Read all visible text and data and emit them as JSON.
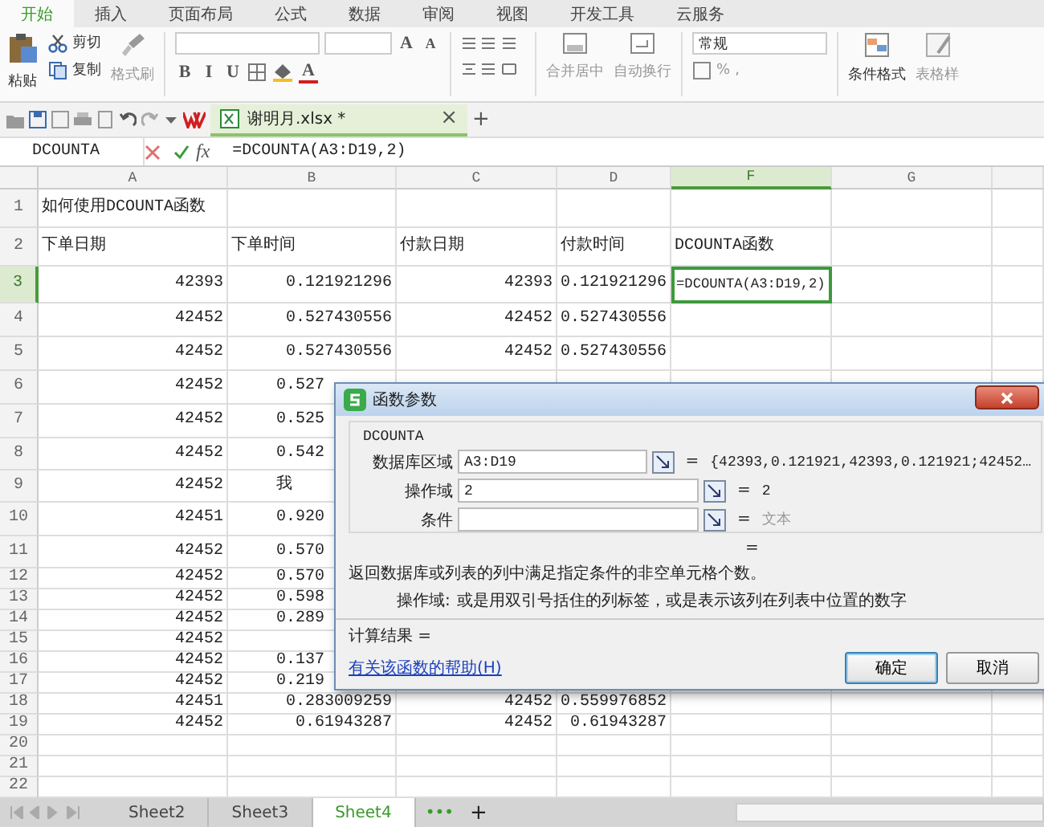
{
  "ribbon_tabs": [
    {
      "label": "开始",
      "selected": true
    },
    {
      "label": "插入",
      "selected": false
    },
    {
      "label": "页面布局",
      "selected": false
    },
    {
      "label": "公式",
      "selected": false
    },
    {
      "label": "数据",
      "selected": false
    },
    {
      "label": "审阅",
      "selected": false
    },
    {
      "label": "视图",
      "selected": false
    },
    {
      "label": "开发工具",
      "selected": false
    },
    {
      "label": "云服务",
      "selected": false
    }
  ],
  "ribbon": {
    "paste": "粘贴",
    "cut": "剪切",
    "copy": "复制",
    "format_painter": "格式刷",
    "font_style_buttons": [
      "B",
      "I",
      "U"
    ],
    "font_size_buttons": [
      "A",
      "A"
    ],
    "font_color": "A",
    "merge_center": "合并居中",
    "wrap_text": "自动换行",
    "number_format": "常规",
    "percent": "%",
    "comma": ",",
    "conditional_format": "条件格式",
    "table_style": "表格样"
  },
  "document_tab": {
    "title": "谢明月.xlsx *",
    "close": "×",
    "new_tab": "+"
  },
  "formula_bar": {
    "name_box": "DCOUNTA",
    "fx": "fx",
    "formula": "=DCOUNTA(A3:D19,2)"
  },
  "sheet": {
    "columns": [
      {
        "label": "A",
        "selected": false
      },
      {
        "label": "B",
        "selected": false
      },
      {
        "label": "C",
        "selected": false
      },
      {
        "label": "D",
        "selected": false
      },
      {
        "label": "F",
        "selected": true
      },
      {
        "label": "G",
        "selected": false
      }
    ],
    "rows": [
      {
        "label": "1",
        "kind": "text",
        "selected": false,
        "cells": [
          "如何使用DCOUNTA函数"
        ]
      },
      {
        "label": "2",
        "kind": "text",
        "selected": false,
        "cells": [
          "下单日期",
          "下单时间",
          "付款日期",
          "付款时间",
          "DCOUNTA函数"
        ]
      },
      {
        "label": "3",
        "kind": "data",
        "selected": true,
        "cells": [
          "42393",
          "0.121921296",
          "42393",
          "0.121921296",
          "=DCOUNTA(A3:D19,2)"
        ]
      },
      {
        "label": "4",
        "kind": "data",
        "selected": false,
        "cells": [
          "42452",
          "0.527430556",
          "42452",
          "0.527430556"
        ]
      },
      {
        "label": "5",
        "kind": "data",
        "selected": false,
        "cells": [
          "42452",
          "0.527430556",
          "42452",
          "0.527430556"
        ]
      },
      {
        "label": "6",
        "kind": "data",
        "selected": false,
        "covered": true,
        "cells": [
          "42452",
          "0.527"
        ]
      },
      {
        "label": "7",
        "kind": "data",
        "selected": false,
        "covered": true,
        "cells": [
          "42452",
          "0.525"
        ]
      },
      {
        "label": "8",
        "kind": "data",
        "selected": false,
        "covered": true,
        "cells": [
          "42452",
          "0.542"
        ]
      },
      {
        "label": "9",
        "kind": "data",
        "selected": false,
        "covered": true,
        "cells": [
          "42452",
          "我"
        ]
      },
      {
        "label": "10",
        "kind": "data",
        "selected": false,
        "covered": true,
        "cells": [
          "42451",
          "0.920"
        ]
      },
      {
        "label": "11",
        "kind": "data",
        "selected": false,
        "covered": true,
        "cells": [
          "42452",
          "0.570"
        ]
      },
      {
        "label": "12",
        "kind": "data",
        "selected": false,
        "covered": true,
        "cells": [
          "42452",
          "0.570"
        ]
      },
      {
        "label": "13",
        "kind": "data",
        "selected": false,
        "covered": true,
        "cells": [
          "42452",
          "0.598"
        ]
      },
      {
        "label": "14",
        "kind": "data",
        "selected": false,
        "covered": true,
        "cells": [
          "42452",
          "0.289"
        ]
      },
      {
        "label": "15",
        "kind": "data",
        "selected": false,
        "cells": [
          "42452"
        ]
      },
      {
        "label": "16",
        "kind": "data",
        "selected": false,
        "covered": true,
        "cells": [
          "42452",
          "0.137"
        ]
      },
      {
        "label": "17",
        "kind": "data",
        "selected": false,
        "covered": true,
        "cells": [
          "42452",
          "0.219"
        ]
      },
      {
        "label": "18",
        "kind": "data",
        "selected": false,
        "cells": [
          "42451",
          "0.283009259",
          "42452",
          "0.559976852"
        ]
      },
      {
        "label": "19",
        "kind": "data",
        "selected": false,
        "cells": [
          "42452",
          "0.61943287",
          "42452",
          "0.61943287"
        ]
      },
      {
        "label": "20",
        "kind": "data",
        "selected": false,
        "cells": []
      },
      {
        "label": "21",
        "kind": "data",
        "selected": false,
        "cells": []
      },
      {
        "label": "22",
        "kind": "data",
        "selected": false,
        "cells": []
      }
    ]
  },
  "dialog": {
    "title": "函数参数",
    "function_name": "DCOUNTA",
    "arguments": [
      {
        "label": "数据库区域",
        "value": "A3:D19",
        "equals": "=",
        "result": "{42393,0.121921,42393,0.121921;42452…",
        "hint": false
      },
      {
        "label": "操作域",
        "value": "2",
        "equals": "=",
        "result": "2",
        "hint": false
      },
      {
        "label": "条件",
        "equals": "=",
        "result": "文本",
        "hint": true
      }
    ],
    "result_equals": "=",
    "description": "返回数据库或列表的列中满足指定条件的非空单元格个数。",
    "argument_help_label": "操作域:",
    "argument_help": "或是用双引号括住的列标签，或是表示该列在列表中位置的数字",
    "calc_result": "计算结果 =",
    "help_link": "有关该函数的帮助(H)",
    "buttons": [
      {
        "label": "确定",
        "default": true
      },
      {
        "label": "取消",
        "default": false
      }
    ]
  },
  "sheet_tabs": [
    {
      "label": "Sheet2",
      "selected": false
    },
    {
      "label": "Sheet3",
      "selected": false
    },
    {
      "label": "Sheet4",
      "selected": true
    }
  ],
  "sheet_tab_more": "•••",
  "sheet_tab_add": "+"
}
